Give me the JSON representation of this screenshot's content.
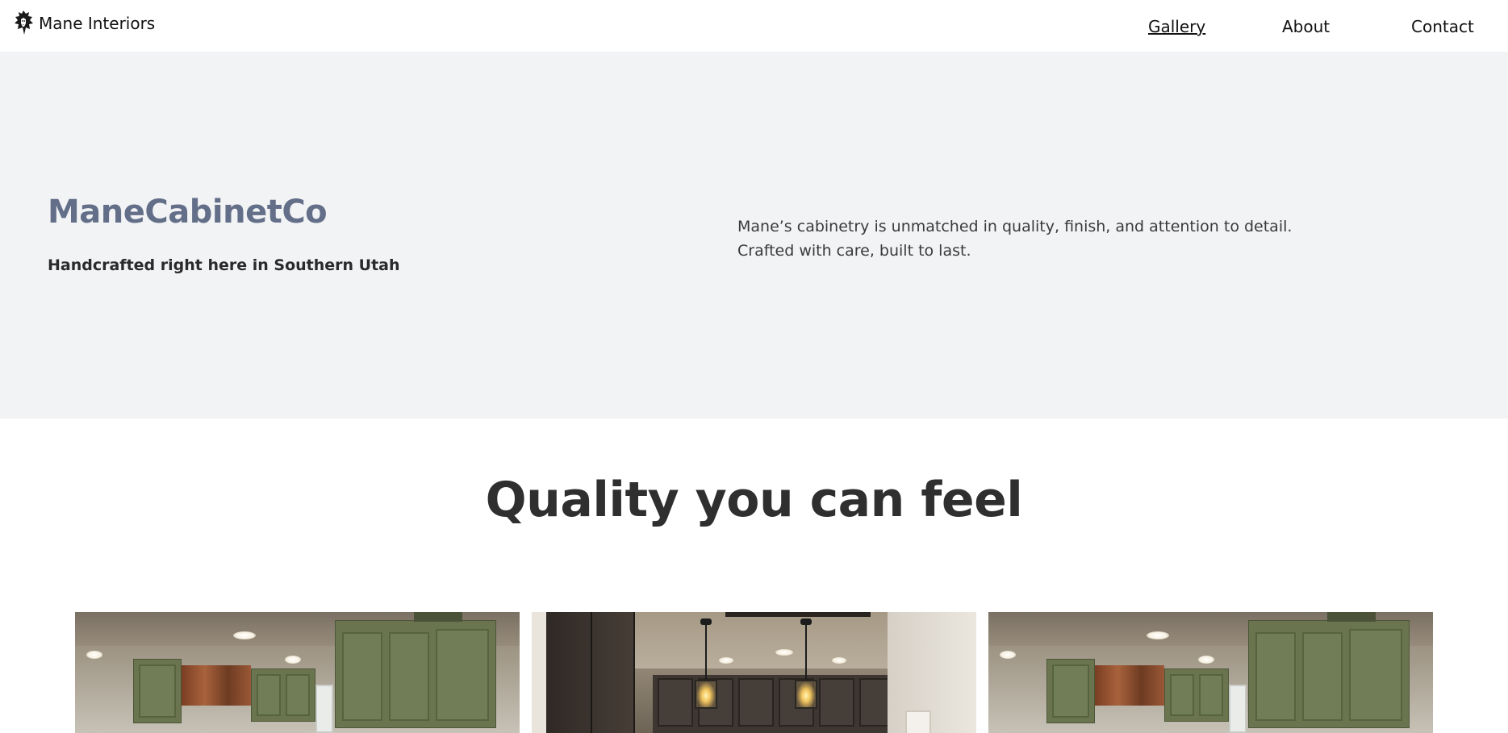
{
  "header": {
    "brand_name": "Mane Interiors",
    "logo_icon": "lion-head-icon",
    "nav": [
      {
        "label": "Gallery",
        "active": true
      },
      {
        "label": "About",
        "active": false
      },
      {
        "label": "Contact",
        "active": false
      }
    ]
  },
  "hero": {
    "title": "ManeCabinetCo",
    "subtitle": "Handcrafted right here in Southern Utah",
    "description_line1": "Mane’s cabinetry is unmatched in quality, finish, and attention to detail.",
    "description_line2": "Crafted with care, built to last."
  },
  "quality": {
    "title": "Quality you can feel"
  },
  "colors": {
    "hero_bg": "#f2f3f5",
    "hero_title": "#636e88",
    "text": "#333333"
  }
}
